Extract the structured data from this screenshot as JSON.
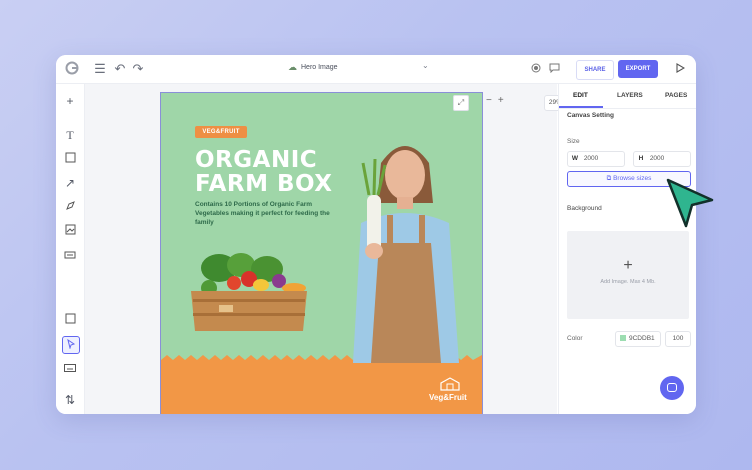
{
  "topbar": {
    "doc_title": "Hero Image",
    "share_label": "SHARE",
    "export_label": "EXPORT"
  },
  "canvas": {
    "zoom": "29%",
    "artboard": {
      "tag": "VEG&FRUIT",
      "headline_line1": "ORGANIC",
      "headline_line2": "FARM BOX",
      "subtitle": "Contains 10 Portions of Organic Farm Vegetables making it perfect for feeding the family",
      "brand": "Veg&Fruit",
      "colors": {
        "background": "#9fd6a8",
        "bottom": "#f29746",
        "tag": "#ee8f44"
      }
    }
  },
  "panel": {
    "tabs": [
      "EDIT",
      "LAYERS",
      "PAGES"
    ],
    "active_tab": "EDIT",
    "section_title": "Canvas Setting",
    "size_label": "Size",
    "width_key": "W",
    "width_value": "2000",
    "height_key": "H",
    "height_value": "2000",
    "browse_label": "Browse sizes",
    "background_label": "Background",
    "upload_hint": "Add Image. Max 4 Mb.",
    "color_label": "Color",
    "color_hex": "9CDDB1",
    "color_opacity": "100"
  },
  "colors": {
    "accent": "#6166f0",
    "cursor": "#2fb58f"
  }
}
